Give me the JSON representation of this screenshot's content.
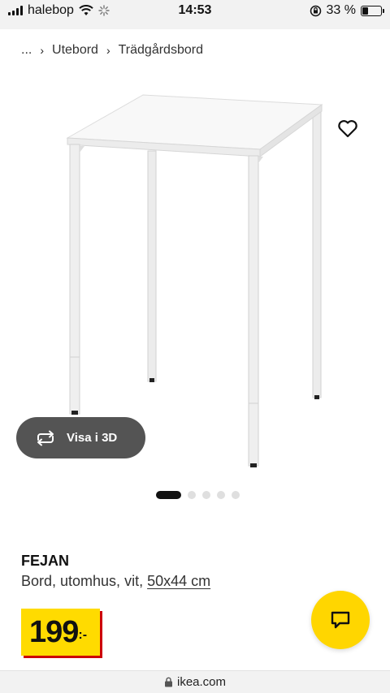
{
  "status_bar": {
    "carrier": "halebop",
    "time": "14:53",
    "battery_text": "33 %",
    "battery_level": 0.33
  },
  "breadcrumb": {
    "ellipsis": "...",
    "items": [
      "Utebord",
      "Trädgårdsbord"
    ]
  },
  "gallery": {
    "view_3d_label": "Visa i 3D",
    "dot_count": 5,
    "active_dot": 0
  },
  "product": {
    "name": "FEJAN",
    "description": "Bord, utomhus, vit,",
    "measure": "50x44 cm",
    "price": "199",
    "price_suffix": ":-"
  },
  "url": "ikea.com",
  "colors": {
    "price_yellow": "#ffdb00",
    "price_shadow": "#cc0008",
    "chat_yellow": "#ffd600"
  }
}
